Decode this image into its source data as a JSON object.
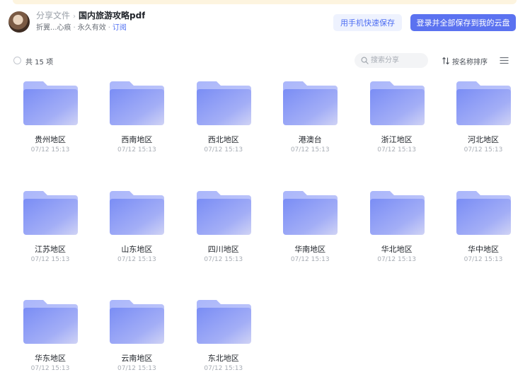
{
  "header": {
    "breadcrumb_parent": "分享文件",
    "breadcrumb_separator": "›",
    "breadcrumb_current": "国内旅游攻略pdf",
    "sharer": "折翼...心痕",
    "validity": "永久有效",
    "subscribe_label": "订阅",
    "phone_save_label": "用手机快速保存",
    "login_save_label": "登录并全部保存到我的云盘"
  },
  "toolbar": {
    "count_label": "共 15 项",
    "search_placeholder": "搜索分享",
    "sort_label": "按名称排序"
  },
  "colors": {
    "accent": "#5b72f0",
    "folder_light": "#aab6fb",
    "folder_dark": "#7a8df5"
  },
  "folders": [
    {
      "name": "贵州地区",
      "date": "07/12 15:13"
    },
    {
      "name": "西南地区",
      "date": "07/12 15:13"
    },
    {
      "name": "西北地区",
      "date": "07/12 15:13"
    },
    {
      "name": "港澳台",
      "date": "07/12 15:13"
    },
    {
      "name": "浙江地区",
      "date": "07/12 15:13"
    },
    {
      "name": "河北地区",
      "date": "07/12 15:13"
    },
    {
      "name": "江苏地区",
      "date": "07/12 15:13"
    },
    {
      "name": "山东地区",
      "date": "07/12 15:13"
    },
    {
      "name": "四川地区",
      "date": "07/12 15:13"
    },
    {
      "name": "华南地区",
      "date": "07/12 15:13"
    },
    {
      "name": "华北地区",
      "date": "07/12 15:13"
    },
    {
      "name": "华中地区",
      "date": "07/12 15:13"
    },
    {
      "name": "华东地区",
      "date": "07/12 15:13"
    },
    {
      "name": "云南地区",
      "date": "07/12 15:13"
    },
    {
      "name": "东北地区",
      "date": "07/12 15:13"
    }
  ]
}
